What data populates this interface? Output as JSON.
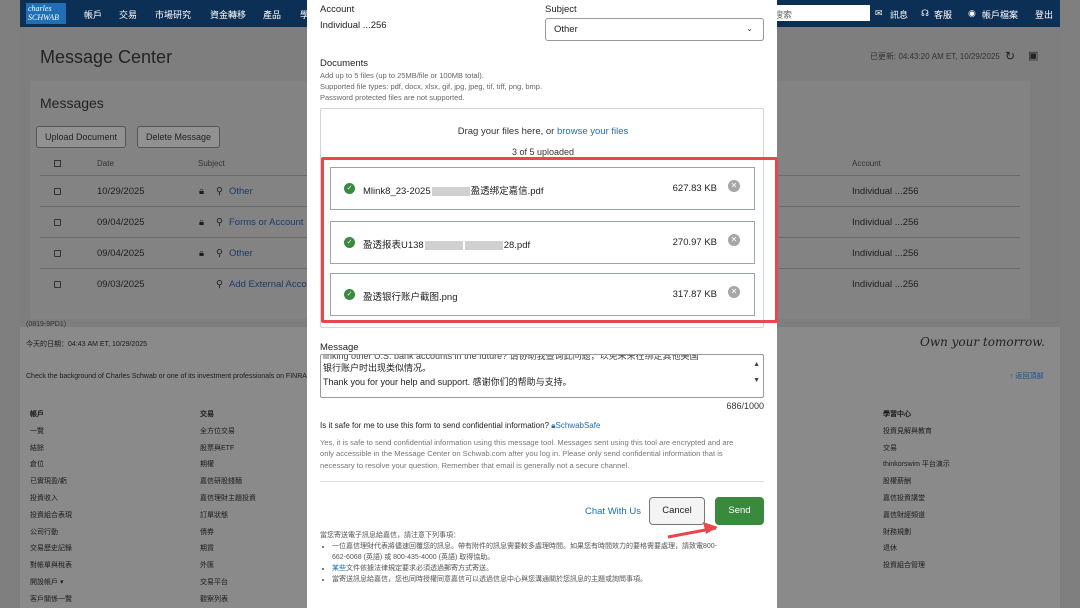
{
  "nav": {
    "logo_line1": "charles",
    "logo_line2": "SCHWAB",
    "items": [
      "帳戶",
      "交易",
      "市場研究",
      "資金轉移",
      "產品",
      "學"
    ],
    "search_placeholder": "搜索",
    "messages_label": "訊息",
    "service_label": "客服",
    "profile_label": "帳戶檔案",
    "logout_label": "登出"
  },
  "page": {
    "title": "Message Center",
    "updated": "已更新: 04:43:20 AM ET, 10/29/2025",
    "messages_heading": "Messages",
    "upload_btn": "Upload Document",
    "delete_btn": "Delete Message",
    "col_date": "Date",
    "col_subject": "Subject",
    "col_account": "Account",
    "rows": [
      {
        "date": "10/29/2025",
        "subject": "Other",
        "account": "Individual ...256"
      },
      {
        "date": "09/04/2025",
        "subject": "Forms or Account",
        "account": "Individual ...256"
      },
      {
        "date": "09/04/2025",
        "subject": "Other",
        "account": "Individual ...256"
      },
      {
        "date": "09/03/2025",
        "subject": "Add External Acco",
        "account": "Individual ...256"
      }
    ]
  },
  "footer": {
    "code": "(0819-9PD1)",
    "today": "今天的日期：04:43 AM ET, 10/29/2025",
    "background": "Check the background of Charles Schwab or one of its investment professionals on FINRA's",
    "slogan": "Own your tomorrow.",
    "back_top": "↑ 返回頂部",
    "col1_head": "帳戶",
    "col1": [
      "一覽",
      "結餘",
      "倉位",
      "已實現盈/虧",
      "投資收入",
      "投資組合表現",
      "公司行動",
      "交易歷史記錄",
      "對帳單與稅表",
      "開設帳戶 ▾",
      "客戶關係一覽"
    ],
    "col2_head": "交易",
    "col2": [
      "全方位交易",
      "股票與ETF",
      "期權",
      "嘉信研股錢麵",
      "嘉信理財主題投資",
      "訂單狀態",
      "債券",
      "期貨",
      "外匯",
      "交易平台",
      "觀察列表"
    ],
    "col3_head": "學習中心",
    "col3": [
      "投資見解與教育",
      "交易",
      "thinkorswim 平台演示",
      "股權薪酬",
      "嘉信投資講堂",
      "嘉信財經頻道",
      "財務規劃",
      "退休",
      "投資組合管理"
    ]
  },
  "modal": {
    "account_label": "Account",
    "account_value": "Individual ...256",
    "subject_label": "Subject",
    "subject_value": "Other",
    "documents_label": "Documents",
    "doc_help_1": "Add up to 5 files (up to 25MB/file or 100MB total).",
    "doc_help_2": "Supported file types: pdf, docx, xlsx, gif, jpg, jpeg, tif, tiff, png, bmp.",
    "doc_help_3": "Password protected files are not supported.",
    "drag_text": "Drag your files here, or ",
    "browse_link": "browse your files",
    "uploaded_count": "3 of 5 uploaded",
    "files": [
      {
        "name_a": "Mlink8_23-2025",
        "name_b": "盈透绑定嘉信.pdf",
        "size": "627.83 KB"
      },
      {
        "name_a": "盈透报表U138",
        "name_b": "28.pdf",
        "size": "270.97 KB"
      },
      {
        "name_a": "盈透银行账户截图.png",
        "name_b": "",
        "size": "317.87 KB"
      }
    ],
    "message_label": "Message",
    "message_line0": "linking other U.S. bank accounts in the future? 请协助我查询此问题，以免未来在绑定其他美国",
    "message_line1": "银行账户时出现类似情况。",
    "message_line2": "Thank you for your help and support.  感谢你们的帮助与支持。",
    "char_count": "686/1000",
    "safe_q": "Is it safe for me to use this form to send confidential information?",
    "safe_link": "SchwabSafe",
    "safe_text_1": "Yes, it is safe to send confidential information using this message tool. Messages sent using this tool are encrypted and are",
    "safe_text_2": "only accessible in the Message Center on Schwab.com after you log in. Please only send confidential information that is",
    "safe_text_3": "necessary to resolve your question. Remember that email is generally not a secure channel.",
    "chat_link": "Chat With Us",
    "cancel_btn": "Cancel",
    "send_btn": "Send",
    "note_head": "當您寄送電子訊息給嘉信，請注意下列事項：",
    "note_1": "一位嘉信理財代表將儘速回覆您的訊息。帶有附件的訊息需要較多處理時間。如果您有時間效力的要格需要處理，請致電800-",
    "note_1b": "662-6068 (英語) 或 800-435-4000 (英語) 取得協助。",
    "note_2_link": "某些",
    "note_2": "文件依據法律規定要求必須透過郵寄方式寄送。",
    "note_3": "當寄送訊息給嘉信，您也同時授權同意嘉信可以透過信息中心與您溝通關於您訊息的主題或詢問事項。"
  },
  "colors": {
    "accent_red": "#e8474b",
    "send_green": "#3a8a3e",
    "link_blue": "#1b6fb2"
  }
}
